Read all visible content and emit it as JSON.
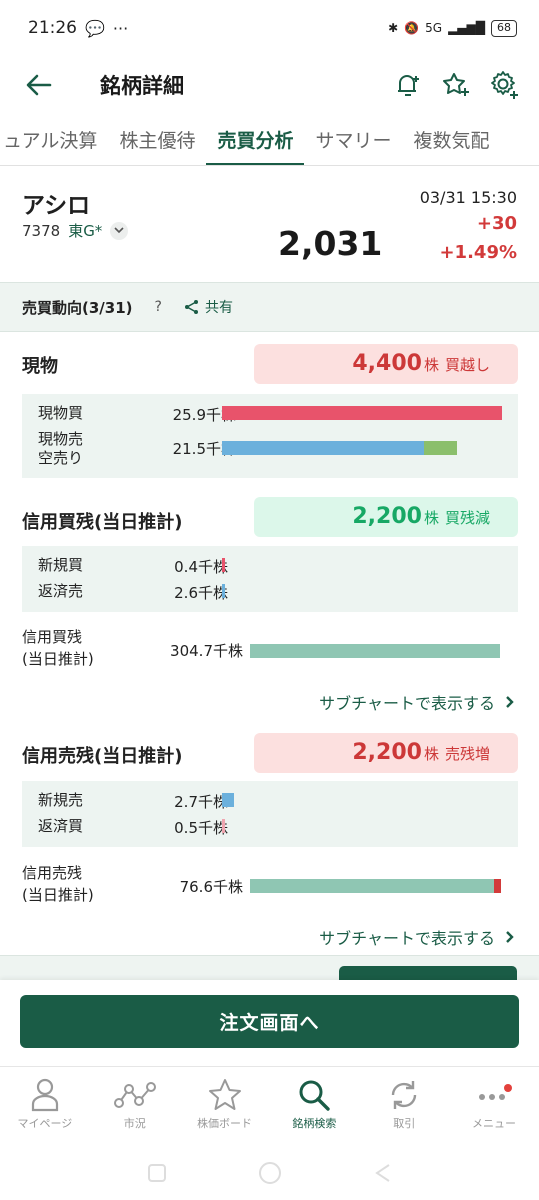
{
  "status": {
    "time": "21:26",
    "battery": "68",
    "network": "5G"
  },
  "appbar": {
    "title": "銘柄詳細"
  },
  "tabs": [
    "ュアル決算",
    "株主優待",
    "売買分析",
    "サマリー",
    "複数気配"
  ],
  "stock": {
    "name": "アシロ",
    "code": "7378",
    "market": "東G*",
    "price": "2,031",
    "datetime": "03/31 15:30",
    "change": "+30",
    "change_pct": "+1.49%"
  },
  "trend": {
    "title": "売買動向(3/31)",
    "help": "?",
    "share": "共有"
  },
  "spot": {
    "title": "現物",
    "summary": {
      "value": "4,400",
      "unit": "株",
      "label": "買越し"
    },
    "buy": {
      "label": "現物買",
      "value": "25.9千株",
      "ratio": 1.0
    },
    "sell": {
      "label": "現物売\n空売り",
      "value": "21.5千株",
      "ratio": 0.83,
      "short_ratio": 0.12
    }
  },
  "margin_buy": {
    "title": "信用買残(当日推計)",
    "summary": {
      "value": "2,200",
      "unit": "株",
      "label": "買残減"
    },
    "new": {
      "label": "新規買",
      "value": "0.4千株"
    },
    "repay": {
      "label": "返済売",
      "value": "2.6千株"
    },
    "balance": {
      "label": "信用買残\n(当日推計)",
      "value": "304.7千株"
    },
    "subchart": "サブチャートで表示する"
  },
  "margin_sell": {
    "title": "信用売残(当日推計)",
    "summary": {
      "value": "2,200",
      "unit": "株",
      "label": "売残増"
    },
    "new": {
      "label": "新規売",
      "value": "2.7千株"
    },
    "repay": {
      "label": "返済買",
      "value": "0.5千株"
    },
    "balance": {
      "label": "信用売残\n(当日推計)",
      "value": "76.6千株"
    },
    "subchart": "サブチャートで表示する"
  },
  "order_button": "注文画面へ",
  "bottom_nav": [
    {
      "label": "マイページ",
      "icon": "person-icon"
    },
    {
      "label": "市況",
      "icon": "market-graph-icon"
    },
    {
      "label": "株価ボード",
      "icon": "star-icon"
    },
    {
      "label": "銘柄検索",
      "icon": "search-icon",
      "active": true
    },
    {
      "label": "取引",
      "icon": "refresh-icon"
    },
    {
      "label": "メニュー",
      "icon": "more-icon"
    }
  ],
  "colors": {
    "brand": "#1a5c46",
    "buy_bar": "#e8536b",
    "sell_bar": "#6bb0dc",
    "short_bar": "#8bbf6c",
    "balance_bar": "#8fc6b3",
    "up": "#d23a3a",
    "down": "#17a865"
  }
}
